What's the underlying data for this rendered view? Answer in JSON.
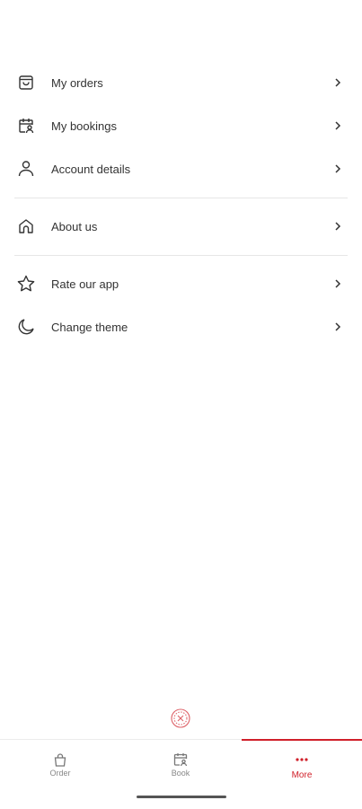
{
  "menu": {
    "group1": [
      {
        "label": "My orders",
        "icon": "shopping-bag-icon"
      },
      {
        "label": "My bookings",
        "icon": "calendar-person-icon"
      },
      {
        "label": "Account details",
        "icon": "person-icon"
      }
    ],
    "group2": [
      {
        "label": "About us",
        "icon": "home-icon"
      }
    ],
    "group3": [
      {
        "label": "Rate our app",
        "icon": "star-icon"
      },
      {
        "label": "Change theme",
        "icon": "moon-icon"
      }
    ]
  },
  "tabbar": {
    "tabs": [
      {
        "label": "Order",
        "icon": "bag-icon"
      },
      {
        "label": "Book",
        "icon": "calendar-person-icon"
      },
      {
        "label": "More",
        "icon": "more-dots-icon"
      }
    ],
    "active_tab": "More"
  },
  "colors": {
    "accent": "#d0202a",
    "text": "#333333",
    "muted": "#888888",
    "divider": "#e6e6e6"
  }
}
